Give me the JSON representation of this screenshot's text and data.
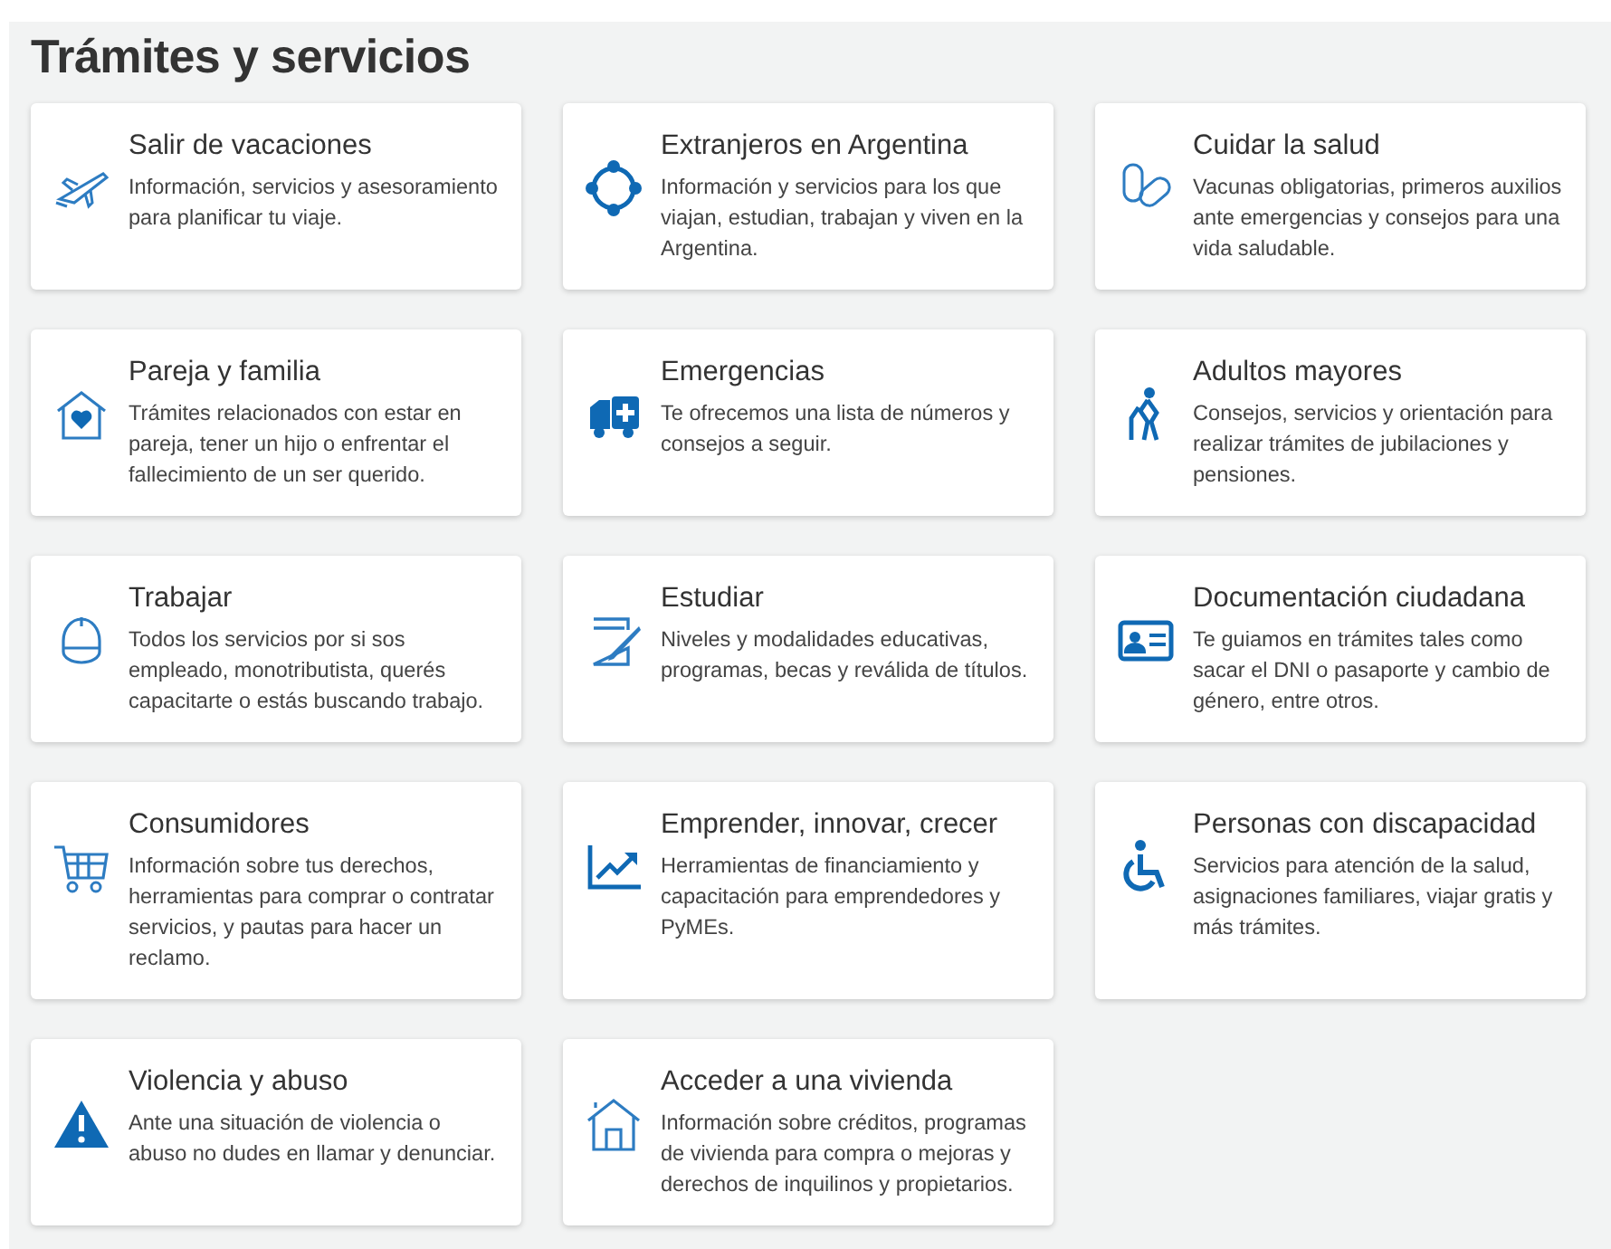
{
  "title": "Trámites y servicios",
  "cards": [
    {
      "title": "Salir de vacaciones",
      "description": "Información, servicios y asesoramiento para planificar tu viaje."
    },
    {
      "title": "Extranjeros en Argentina",
      "description": "Información y servicios para los que viajan, estudian, trabajan y viven en la Argentina."
    },
    {
      "title": "Cuidar la salud",
      "description": "Vacunas obligatorias, primeros auxilios ante emergencias y consejos para una vida saludable."
    },
    {
      "title": "Pareja y familia",
      "description": "Trámites relacionados con estar en pareja, tener un hijo o enfrentar el fallecimiento de un ser querido."
    },
    {
      "title": "Emergencias",
      "description": "Te ofrecemos una lista de números y consejos a seguir."
    },
    {
      "title": "Adultos mayores",
      "description": "Consejos, servicios y orientación para realizar trámites de jubilaciones y pensiones."
    },
    {
      "title": "Trabajar",
      "description": "Todos los servicios por si sos empleado, monotributista, querés capacitarte o estás buscando trabajo."
    },
    {
      "title": "Estudiar",
      "description": "Niveles y modalidades educativas, programas, becas y reválida de títulos."
    },
    {
      "title": "Documentación ciudadana",
      "description": "Te guiamos en trámites tales como sacar el DNI o pasaporte y cambio de género, entre otros."
    },
    {
      "title": "Consumidores",
      "description": "Información sobre tus derechos, herramientas para comprar o contratar servicios, y pautas para hacer un reclamo."
    },
    {
      "title": "Emprender, innovar, crecer",
      "description": "Herramientas de financiamiento y capacitación para emprendedores y PyMEs."
    },
    {
      "title": "Personas con discapacidad",
      "description": "Servicios para atención de la salud, asignaciones familiares, viajar gratis y más trámites."
    },
    {
      "title": "Violencia y abuso",
      "description": "Ante una situación de violencia o abuso no dudes en llamar y denunciar."
    },
    {
      "title": "Acceder a una vivienda",
      "description": "Información sobre créditos, programas de vivienda para compra o mejoras y derechos de inquilinos y propietarios."
    }
  ]
}
